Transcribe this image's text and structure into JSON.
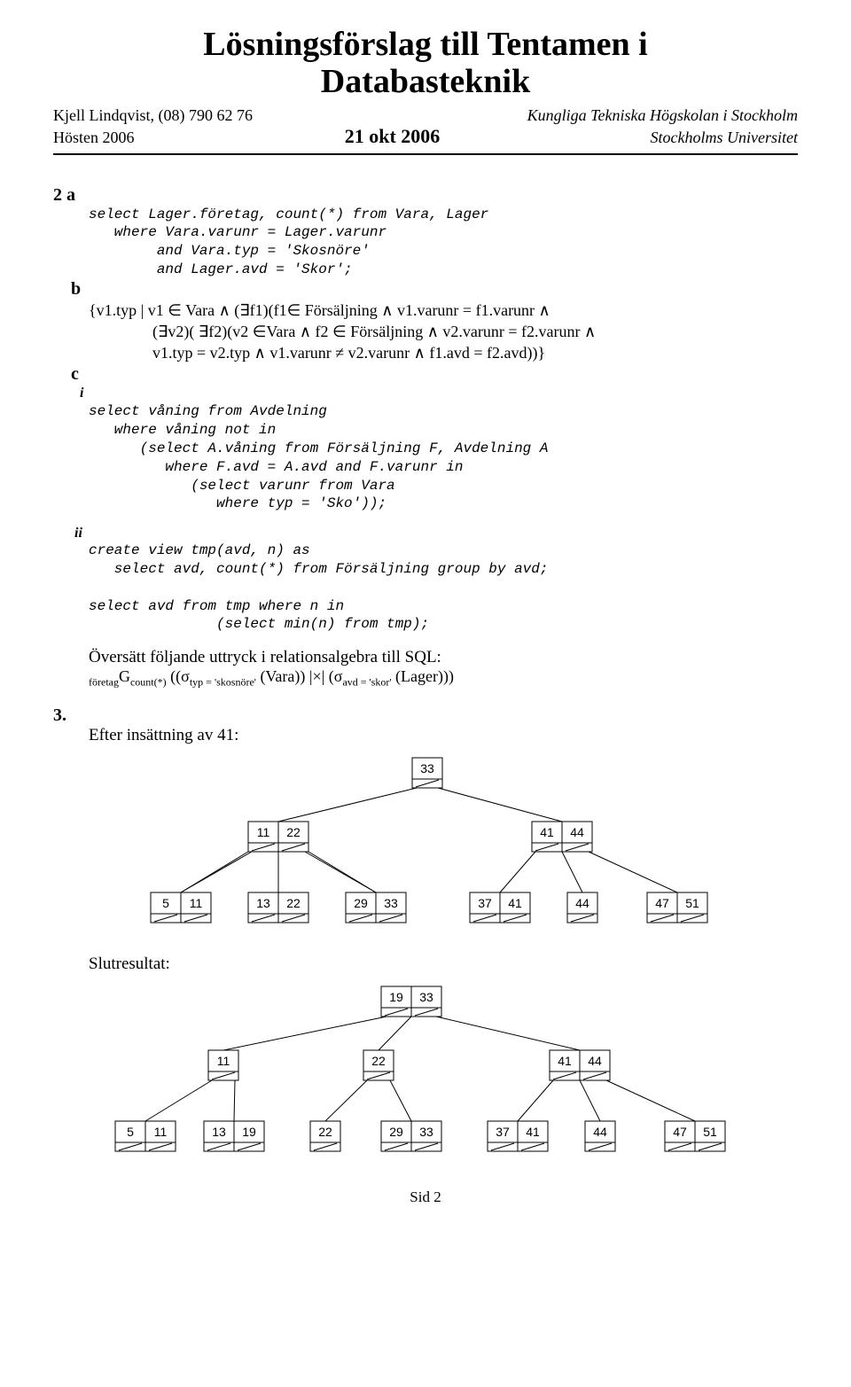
{
  "title_line1": "Lösningsförslag till Tentamen i",
  "title_line2": "Databasteknik",
  "header": {
    "left1": "Kjell Lindqvist, (08) 790 62 76",
    "left2": "Hösten 2006",
    "center": "21 okt 2006",
    "right1": "Kungliga Tekniska Högskolan i Stockholm",
    "right2": "Stockholms Universitet"
  },
  "labels": {
    "q2a": "2 a",
    "b": "b",
    "c": "c",
    "i": "i",
    "ii": "ii",
    "q3": "3."
  },
  "code_2a": "select Lager.företag, count(*) from Vara, Lager\n   where Vara.varunr = Lager.varunr\n        and Vara.typ = 'Skosnöre'\n        and Lager.avd = 'Skor';",
  "math_b": "{v1.typ | v1 ∈ Vara ∧ (∃f1)(f1∈ Försäljning ∧ v1.varunr = f1.varunr ∧\n                (∃v2)( ∃f2)(v2 ∈Vara ∧ f2 ∈ Försäljning ∧ v2.varunr = f2.varunr ∧\n                v1.typ = v2.typ ∧ v1.varunr ≠ v2.varunr ∧ f1.avd = f2.avd))}",
  "code_ci": "select våning from Avdelning\n   where våning not in\n      (select A.våning from Försäljning F, Avdelning A\n         where F.avd = A.avd and F.varunr in\n            (select varunr from Vara\n               where typ = 'Sko'));",
  "code_cii": "create view tmp(avd, n) as\n   select avd, count(*) from Försäljning group by avd;\n\nselect avd from tmp where n in\n               (select min(n) from tmp);",
  "ra_intro": "Översätt följande uttryck i relationsalgebra till SQL:",
  "after_insert": "Efter insättning av 41:",
  "slutresultat": "Slutresultat:",
  "tree1": {
    "root": [
      "33"
    ],
    "mid_left": [
      "11",
      "22"
    ],
    "mid_right": [
      "41",
      "44"
    ],
    "leaves": [
      [
        "5",
        "11"
      ],
      [
        "13",
        "22"
      ],
      [
        "29",
        "33"
      ],
      [
        "37",
        "41"
      ],
      [
        "44"
      ],
      [
        "47",
        "51"
      ]
    ]
  },
  "tree2": {
    "root": [
      "19",
      "33"
    ],
    "mid_left": [
      "11"
    ],
    "mid_center": [
      "22"
    ],
    "mid_right": [
      "41",
      "44"
    ],
    "leaves": [
      [
        "5",
        "11"
      ],
      [
        "13",
        "19"
      ],
      [
        "22"
      ],
      [
        "29",
        "33"
      ],
      [
        "37",
        "41"
      ],
      [
        "44"
      ],
      [
        "47",
        "51"
      ]
    ]
  },
  "footer": "Sid 2"
}
